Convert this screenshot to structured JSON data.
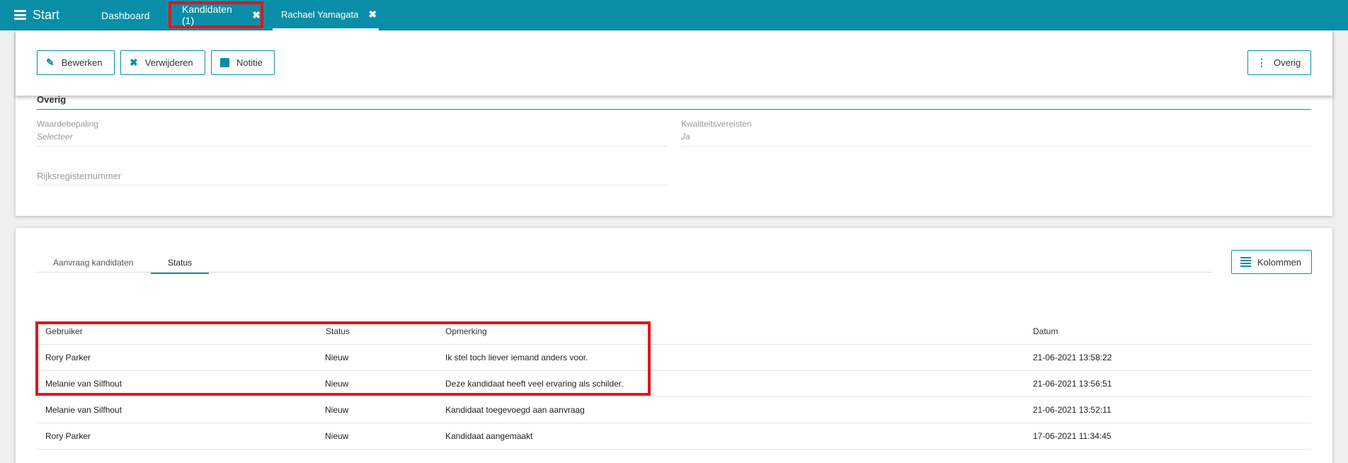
{
  "topbar": {
    "start_label": "Start",
    "tabs": [
      {
        "label": "Dashboard"
      },
      {
        "label": "Kandidaten (1)",
        "close": "✖"
      },
      {
        "label": "Rachael Yamagata",
        "close": "✖"
      }
    ]
  },
  "toolbar": {
    "bewerken": "Bewerken",
    "verwijderen": "Verwijderen",
    "notitie": "Notitie",
    "overig": "Overig"
  },
  "details": {
    "section_title": "Overig",
    "waardebepaling_label": "Waardebepaling",
    "waardebepaling_value": "Selecteer",
    "kwaliteitsvereisten_label": "Kwaliteitsvereisten",
    "kwaliteitsvereisten_value": "Ja",
    "rijksregisternummer_label": "Rijksregisternummer"
  },
  "bottom": {
    "tabs": [
      "Aanvraag kandidaten",
      "Status"
    ],
    "active_tab": "Status",
    "kolommen": "Kolommen",
    "columns": [
      "Gebruiker",
      "Status",
      "Opmerking",
      "Datum"
    ],
    "rows": [
      [
        "Rory Parker",
        "Nieuw",
        "Ik stel toch liever iemand anders voor.",
        "21-06-2021 13:58:22"
      ],
      [
        "Melanie van Silfhout",
        "Nieuw",
        "Deze kandidaat heeft veel ervaring als schilder.",
        "21-06-2021 13:56:51"
      ],
      [
        "Melanie van Silfhout",
        "Nieuw",
        "Kandidaat toegevoegd aan aanvraag",
        "21-06-2021 13:52:11"
      ],
      [
        "Rory Parker",
        "Nieuw",
        "Kandidaat aangemaakt",
        "17-06-2021 11:34:45"
      ]
    ]
  },
  "colors": {
    "accent": "#0a8ea8",
    "highlight": "#e3151d"
  }
}
